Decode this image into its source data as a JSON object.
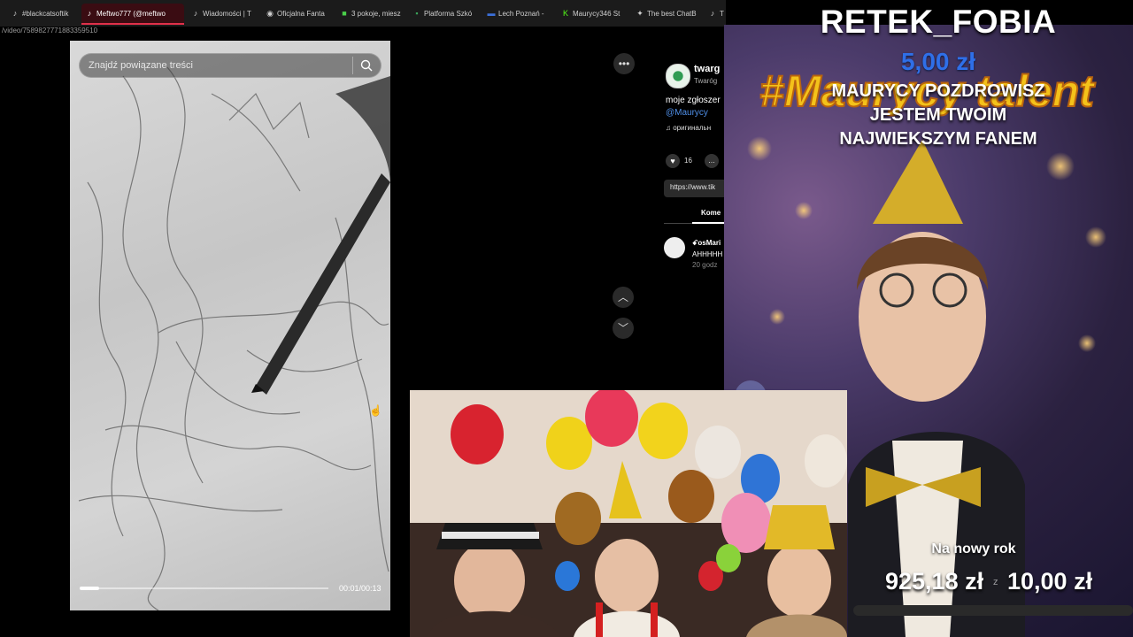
{
  "browser": {
    "tabs": [
      {
        "label": "#blackcatsoftik",
        "icon": "tiktok-icon",
        "active": false
      },
      {
        "label": "Meftwo777 (@meftwo",
        "icon": "tiktok-icon",
        "active": true
      },
      {
        "label": "Wiadomości | T",
        "icon": "tiktok-icon",
        "active": false
      },
      {
        "label": "Oficjalna Fanta",
        "icon": "globe-icon",
        "active": false
      },
      {
        "label": "3 pokoje, miesz",
        "icon": "olx-icon",
        "active": false
      },
      {
        "label": "Platforma Szkó",
        "icon": "school-icon",
        "active": false
      },
      {
        "label": "Lech Poznań - ",
        "icon": "site-icon",
        "active": false
      },
      {
        "label": "Maurycy346 St",
        "icon": "kick-icon",
        "active": false
      },
      {
        "label": "The best ChatB",
        "icon": "chatgpt-icon",
        "active": false
      },
      {
        "label": "T",
        "icon": "tiktok-icon",
        "active": false
      }
    ],
    "url": "/video/7589827771883359510"
  },
  "player": {
    "search_placeholder": "Znajdź powiązane treści",
    "time": "00:01/00:13",
    "progress": 0.077
  },
  "info": {
    "author": "twarg",
    "author_sub": "Twaróg",
    "description": "moje zgłoszer",
    "mention": "@Maurycy",
    "music": "оригинальн",
    "likes": "16",
    "link": "https://www.tik",
    "tab_label": "Kome",
    "comment_user": "ꗃosMari",
    "comment_text": "AHHHHH",
    "comment_time": "20 godz"
  },
  "overlay": {
    "donor_name": "RETEK_FOBIA",
    "donation_amount": "5,00 zł",
    "logo_text": "#Maurycy talent",
    "message_lines": [
      "MAURYCY POZDROWISZ",
      "JESTEM TWOIM",
      "NAJWIEKSZYM FANEM"
    ],
    "goal_label": "Na nowy rok",
    "goal_current": "925,18 zł",
    "goal_separator": "z",
    "goal_target": "10,00 zł"
  },
  "colors": {
    "accent_blue": "#2f6fe8",
    "logo_yellow": "#f4c21a",
    "tab_active": "#e0304a"
  }
}
